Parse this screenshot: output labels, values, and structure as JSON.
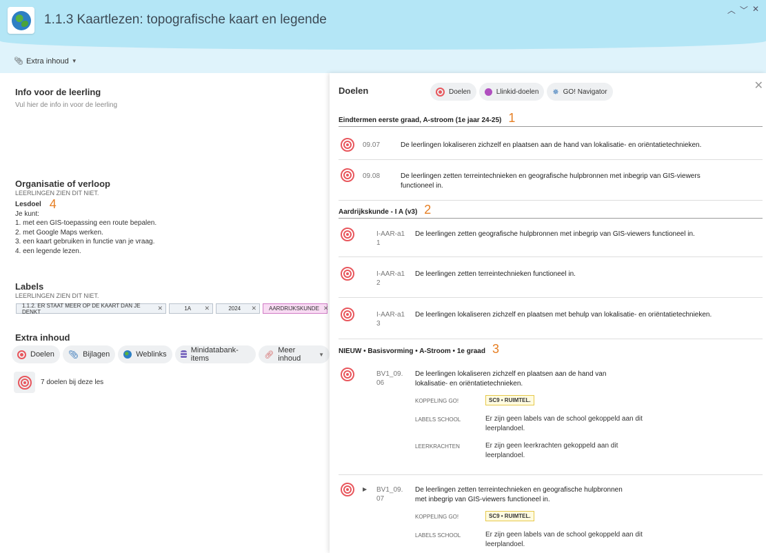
{
  "header": {
    "title": "1.1.3 Kaartlezen: topografische kaart en legende",
    "extra_toggle": "Extra inhoud",
    "logo_icon": "globe-icon"
  },
  "left": {
    "info_title": "Info voor de leerling",
    "info_placeholder": "Vul hier de info in voor de leerling",
    "org_title": "Organisatie of verloop",
    "org_note": "LEERLINGEN ZIEN DIT NIET.",
    "lesdoel_label": "Lesdoel",
    "lesdoel_marker": "4",
    "lesdoel_lines": [
      "Je kunt:",
      "1. met een GIS-toepassing een route bepalen.",
      "2. met Google Maps werken.",
      "3. een kaart gebruiken in functie van je vraag.",
      "4. een legende lezen."
    ],
    "labels_title": "Labels",
    "labels_note": "LEERLINGEN ZIEN DIT NIET.",
    "tags": [
      "1.1.2. ER STAAT MEER OP DE KAART DAN JE DENKT",
      "1A",
      "2024",
      "AARDRIJKSKUNDE"
    ],
    "extra_title": "Extra inhoud",
    "buttons": [
      "Doelen",
      "Bijlagen",
      "Weblinks",
      "Minidatabank-items",
      "Meer inhoud"
    ],
    "doelen_summary": "7 doelen bij deze les"
  },
  "right": {
    "title": "Doelen",
    "buttons": [
      "Doelen",
      "Llinkid-doelen",
      "GO! Navigator"
    ],
    "sections": [
      {
        "heading": "Eindtermen eerste graad, A-stroom (1e jaar 24-25)",
        "marker": "1",
        "goals": [
          {
            "code": "09.07",
            "text": "De leerlingen lokaliseren zichzelf en plaatsen aan de hand van lokalisatie- en oriëntatietechnieken."
          },
          {
            "code": "09.08",
            "text_lines": [
              "De leerlingen zetten terreintechnieken en geografische hulpbronnen met inbegrip van GIS-viewers",
              "functioneel in."
            ]
          }
        ]
      },
      {
        "heading": "Aardrijkskunde - I A (v3)",
        "marker": "2",
        "goals": [
          {
            "code_lines": [
              "I-AAR-a1",
              "1"
            ],
            "text": "De leerlingen zetten geografische hulpbronnen met inbegrip van GIS-viewers functioneel in."
          },
          {
            "code_lines": [
              "I-AAR-a1",
              "2"
            ],
            "text": "De leerlingen zetten terreintechnieken functioneel in."
          },
          {
            "code_lines": [
              "I-AAR-a1",
              "3"
            ],
            "text": "De leerlingen lokaliseren zichzelf en plaatsen met behulp van lokalisatie- en oriëntatietechnieken."
          }
        ]
      },
      {
        "heading": "NIEUW • Basisvorming • A-Stroom • 1e graad",
        "marker": "3",
        "goals": [
          {
            "code_lines": [
              "BV1_09.",
              "06"
            ],
            "text_lines": [
              "De leerlingen lokaliseren zichzelf en plaatsen aan de hand van",
              "lokalisatie- en oriëntatietechnieken."
            ],
            "meta": [
              {
                "label": "KOPPELING GO!",
                "badge": "SC9 • RUIMTEL."
              },
              {
                "label": "LABELS SCHOOL",
                "value_lines": [
                  "Er zijn geen labels van de school gekoppeld aan dit",
                  "leerplandoel."
                ]
              },
              {
                "label": "LEERKRACHTEN",
                "value_lines": [
                  "Er zijn geen leerkrachten gekoppeld aan dit",
                  "leerplandoel."
                ]
              }
            ]
          },
          {
            "code_lines": [
              "BV1_09.",
              "07"
            ],
            "text_lines": [
              "De leerlingen zetten terreintechnieken en geografische hulpbronnen",
              "met inbegrip van GIS-viewers functioneel in."
            ],
            "meta": [
              {
                "label": "KOPPELING GO!",
                "badge": "SC9 • RUIMTEL."
              },
              {
                "label": "LABELS SCHOOL",
                "value_lines": [
                  "Er zijn geen labels van de school gekoppeld aan dit",
                  "leerplandoel."
                ]
              }
            ]
          }
        ]
      }
    ]
  }
}
